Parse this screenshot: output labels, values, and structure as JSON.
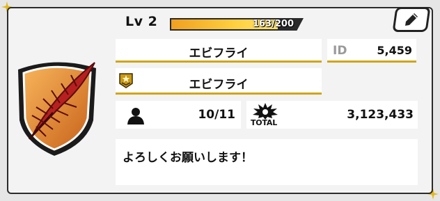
{
  "header": {
    "level_label": "Lv 2",
    "xp_text": "163/200",
    "xp_current": 163,
    "xp_max": 200
  },
  "profile": {
    "name": "エビフライ",
    "title": "エビフライ",
    "id_label": "ID",
    "id_value": "5,459"
  },
  "stats": {
    "members": "10/11",
    "total_label": "TOTAL",
    "total_value": "3,123,433"
  },
  "message": "よろしくお願いします！",
  "icons": {
    "edit": "pencil-icon",
    "emblem": "feather-shield-emblem",
    "rank": "rank-badge-icon",
    "members": "person-icon",
    "total": "burst-icon"
  },
  "colors": {
    "accent_gold": "#d2a414",
    "xp_fill": "#ffd040",
    "emblem_orange": "#e08a2a",
    "feather_red": "#b82020"
  }
}
